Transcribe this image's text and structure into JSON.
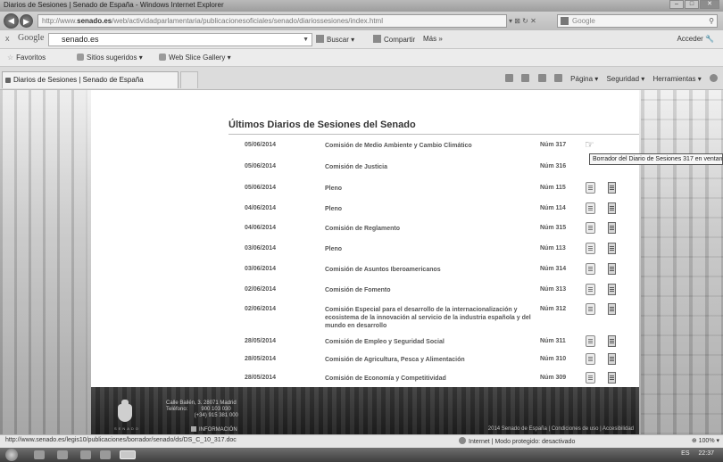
{
  "window": {
    "title": "Diarios de Sesiones | Senado de España - Windows Internet Explorer",
    "controls": [
      "–",
      "□",
      "✕"
    ]
  },
  "address_bar": {
    "url_prefix": "http://www.",
    "url_domain": "senado.es",
    "url_rest": "/web/actividadparlamentaria/publicacionesoficiales/senado/diariossesiones/index.html",
    "controls": "▾ ⊠ ↻ ✕",
    "search_placeholder": "Google"
  },
  "google_toolbar": {
    "close": "x",
    "logo": "Google",
    "query": "senado.es",
    "buttons": [
      "Buscar ▾",
      "Compartir",
      "Más »"
    ],
    "login": "Acceder 🔧"
  },
  "favorites_bar": {
    "favorites": "Favoritos",
    "suggested": "Sitios sugeridos ▾",
    "slice": "Web Slice Gallery ▾"
  },
  "tab": {
    "label": "Diarios de Sesiones | Senado de España"
  },
  "command_bar": {
    "items": [
      "Página ▾",
      "Seguridad ▾",
      "Herramientas ▾"
    ]
  },
  "page": {
    "heading": "Últimos Diarios de Sesiones del Senado",
    "rows": [
      {
        "date": "05/06/2014",
        "desc": "Comisión de Medio Ambiente y Cambio Climático",
        "num": "Núm 317"
      },
      {
        "date": "05/06/2014",
        "desc": "Comisión de Justicia",
        "num": "Núm 316"
      },
      {
        "date": "05/06/2014",
        "desc": "Pleno",
        "num": "Núm 115"
      },
      {
        "date": "04/06/2014",
        "desc": "Pleno",
        "num": "Núm 114"
      },
      {
        "date": "04/06/2014",
        "desc": "Comisión de Reglamento",
        "num": "Núm 315"
      },
      {
        "date": "03/06/2014",
        "desc": "Pleno",
        "num": "Núm 113"
      },
      {
        "date": "03/06/2014",
        "desc": "Comisión de Asuntos Iberoamericanos",
        "num": "Núm 314"
      },
      {
        "date": "02/06/2014",
        "desc": "Comisión de Fomento",
        "num": "Núm 313"
      },
      {
        "date": "02/06/2014",
        "desc": "Comisión Especial para el desarrollo de la internacionalización y ecosistema de la innovación al servicio de la industria española y del mundo en desarrollo",
        "num": "Núm 312"
      },
      {
        "date": "28/05/2014",
        "desc": "Comisión de Empleo y Seguridad Social",
        "num": "Núm 311"
      },
      {
        "date": "28/05/2014",
        "desc": "Comisión de Agricultura, Pesca y Alimentación",
        "num": "Núm 310"
      },
      {
        "date": "28/05/2014",
        "desc": "Comisión de Economía y Competitividad",
        "num": "Núm 309"
      }
    ],
    "tooltip": "Borrador del Diario de Sesiones 317 en ventana nueva"
  },
  "footer": {
    "address": "Calle Bailén, 3. 28071 Madrid\nTeléfono:         900 103 030\n                   (+34) 915 381 000",
    "info": "INFORMACIÓN",
    "seal_text": "SENADO",
    "legal": "2014 Senado de España | Condiciones de uso | Accesibilidad"
  },
  "status_bar": {
    "url": "http://www.senado.es/legis10/publicaciones/borrador/senado/ds/DS_C_10_317.doc",
    "zone": "Internet | Modo protegido: desactivado",
    "zoom": "⊕ 100% ▾"
  },
  "taskbar": {
    "lang": "ES",
    "time": "22:37"
  }
}
